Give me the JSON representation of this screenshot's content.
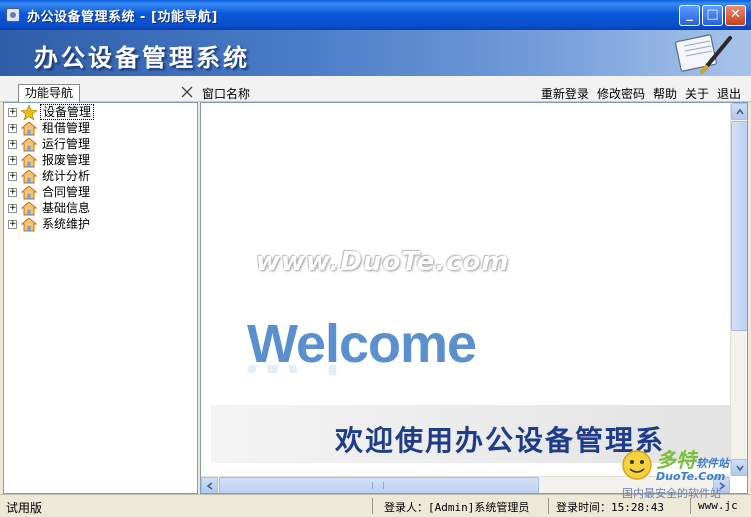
{
  "window": {
    "title": "办公设备管理系统 - [功能导航]",
    "minimize_glyph": "_",
    "maximize_glyph": "□",
    "close_glyph": "✕"
  },
  "banner": {
    "title": "办公设备管理系统"
  },
  "toolbar": {
    "nav_tab_label": "功能导航",
    "window_name_label": "窗口名称",
    "menu": [
      "重新登录",
      "修改密码",
      "帮助",
      "关于",
      "退出"
    ]
  },
  "tree": {
    "items": [
      {
        "label": "设备管理",
        "icon": "star-icon",
        "selected": true
      },
      {
        "label": "租借管理",
        "icon": "house-icon"
      },
      {
        "label": "运行管理",
        "icon": "house-icon"
      },
      {
        "label": "报废管理",
        "icon": "house-icon"
      },
      {
        "label": "统计分析",
        "icon": "house-icon"
      },
      {
        "label": "合同管理",
        "icon": "house-icon"
      },
      {
        "label": "基础信息",
        "icon": "house-icon"
      },
      {
        "label": "系统维护",
        "icon": "house-icon"
      }
    ],
    "expander_glyph": "+"
  },
  "content": {
    "watermark": "www.DuoTe.com",
    "welcome": "Welcome",
    "slogan": "欢迎使用办公设备管理系"
  },
  "status": {
    "mode": "试用版",
    "login_user": "登录人：[Admin]系统管理员",
    "login_time": "登录时间：15:28:43",
    "site": "www.jc"
  },
  "corner_logo": {
    "brand": "多特",
    "brand_suffix": "软件站",
    "domain": "DuoTe.Com",
    "tagline": "国内最安全的软件站"
  },
  "colors": {
    "titlebar": "#0a58d8",
    "banner": "#4a7cc8",
    "welcome": "#5a8fd0",
    "slogan": "#1f3c8a"
  }
}
